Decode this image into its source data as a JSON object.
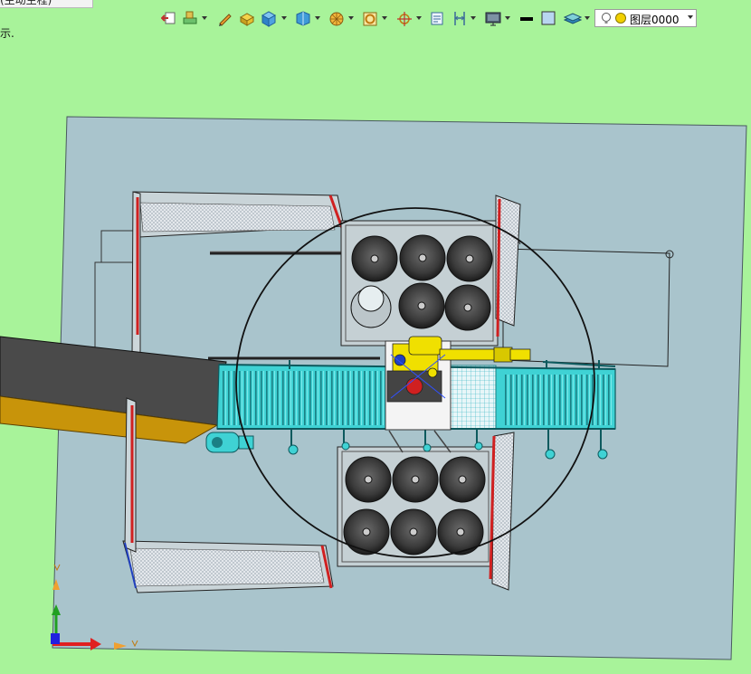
{
  "document_tab": {
    "title": "(主动生程)",
    "arrow": "▾"
  },
  "hint_text": "示.",
  "toolbar": {
    "tools": [
      {
        "icon": "exit-sketch-icon"
      },
      {
        "icon": "insert-component-icon",
        "dropdown": true
      },
      {
        "icon": "pencil-icon"
      },
      {
        "icon": "extrude-block-icon"
      },
      {
        "icon": "cube-icon",
        "dropdown": true
      },
      {
        "icon": "view-orientation-icon",
        "dropdown": true
      },
      {
        "icon": "render-style-icon",
        "dropdown": true
      },
      {
        "icon": "ring-icon",
        "dropdown": true
      },
      {
        "icon": "triad-icon",
        "dropdown": true
      },
      {
        "icon": "section-view-icon"
      },
      {
        "icon": "dimension-icon",
        "dropdown": true
      },
      {
        "icon": "monitor-icon",
        "dropdown": true
      },
      {
        "icon": "line-color-icon"
      },
      {
        "icon": "fill-color-icon"
      },
      {
        "icon": "layers-icon",
        "dropdown": true
      }
    ],
    "layer_select": {
      "value": "图层0000"
    }
  },
  "scene": {
    "background": "#a8f39a",
    "platform_color": "#a9c4cc",
    "conveyor_color": "#3fd2d4",
    "robot_color": "#f0e000",
    "fence_color": "#dcdcdc",
    "guard_red": "#d02020",
    "ramp_color": "#4a4a4a",
    "ramp_edge_color": "#c8940a",
    "axes": {
      "x_color": "#e02020",
      "y_color": "#20a020",
      "z_color": "#2020e0"
    }
  }
}
